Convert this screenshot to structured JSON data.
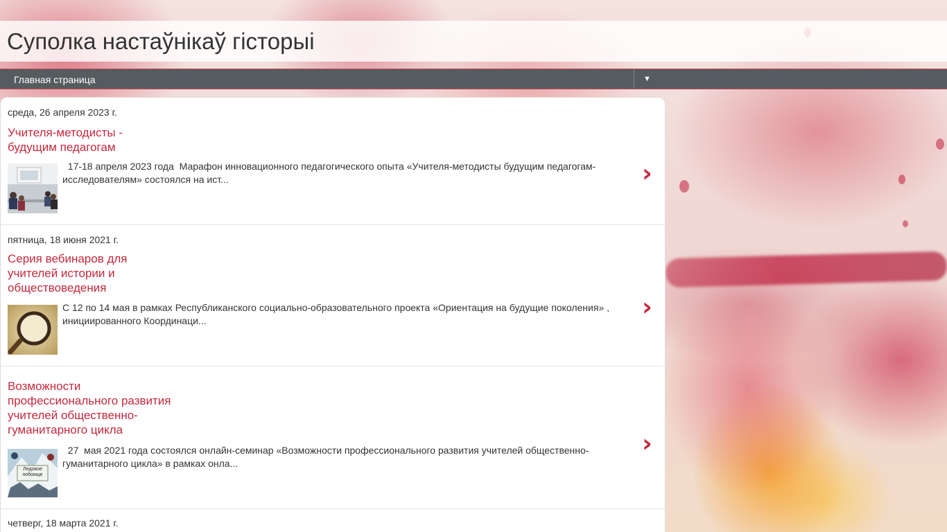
{
  "blog": {
    "title": "Суполка настаўнікаў гісторыі"
  },
  "nav": {
    "home_label": "Главная страница",
    "dropdown_glyph": "▼"
  },
  "posts": [
    {
      "date": "среда, 26 апреля 2023 г.",
      "title_lines": [
        "Учителя-методисты -",
        "будущим педагогам"
      ],
      "snippet": "  17-18 апреля 2023 года  Марафон инновационного педагогического опыта «Учителя-методисты будущим педагогам-исследователям» состоялся на ист...",
      "thumb": "classroom-photo"
    },
    {
      "date": "пятница, 18 июня 2021 г.",
      "title_lines": [
        "Серия вебинаров для",
        "учителей истории и",
        "обществоведения"
      ],
      "snippet": "С 12 по 14 мая в рамках  Республиканского социально-образовательного проекта «Ориентация на будущие поколения» , инициированного Координаци...",
      "thumb": "magnifier-history-image"
    },
    {
      "date": "",
      "title_lines": [
        "Возможности",
        "профессионального развития",
        "учителей общественно-",
        "гуманитарного цикла"
      ],
      "snippet": "  27  мая 2021 года состоялся онлайн-семинар «Возможности профессионального развития учителей общественно-гуманитарного цикла» в рамках онла...",
      "thumb": "ice-battle-image",
      "thumb_caption": "Ледовое побоище"
    },
    {
      "date": "четверг, 18 марта 2021 г."
    }
  ],
  "arrow_glyph": "›"
}
